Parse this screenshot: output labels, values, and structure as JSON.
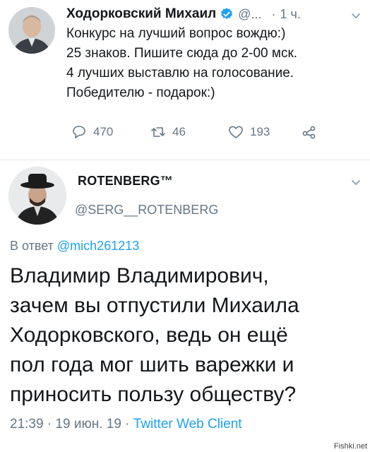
{
  "tweet1": {
    "author_name": "Ходорковский Михаил",
    "author_handle": "@...",
    "separator": "·",
    "time": "1 ч.",
    "text_lines": [
      "Конкурс на лучший вопрос вождю:)",
      "25 знаков. Пишите сюда до 2-00 мск.",
      "4 лучших выставлю на голосование.",
      "Победителю - подарок:)"
    ],
    "replies": "470",
    "retweets": "46",
    "likes": "193",
    "icons": [
      "verified-icon",
      "reply-icon",
      "retweet-icon",
      "like-icon",
      "share-icon",
      "chevron-down-icon"
    ]
  },
  "tweet2": {
    "author_name": "ROTENBERG™",
    "author_handle": "@SERG__ROTENBERG",
    "reply_prefix": "В ответ",
    "reply_mention": "@mich261213",
    "text_lines": [
      "Владимир Владимирович,",
      "зачем вы отпустили Михаила",
      "Ходорковского, ведь он ещё",
      "пол года мог шить варежки и",
      "приносить пользу обществу?"
    ],
    "time": "21:39 · 19 июн. 19 ·",
    "source": "Twitter Web Client"
  },
  "watermark": "Fishki.net",
  "colors": {
    "text": "#14171a",
    "secondary": "#657786",
    "link": "#1da1f2",
    "divider": "#e1e8ed"
  }
}
